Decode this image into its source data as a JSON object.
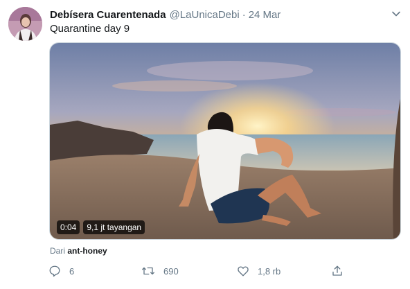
{
  "tweet": {
    "display_name": "Debísera Cuarentenada",
    "handle": "@LaUnicaDebi",
    "separator": "·",
    "date": "24 Mar",
    "text": "Quarantine day 9"
  },
  "video": {
    "duration": "0:04",
    "views": "9,1 jt tayangan"
  },
  "attribution": {
    "prefix": "Dari",
    "source": "ant-honey"
  },
  "actions": {
    "reply_count": "6",
    "retweet_count": "690",
    "like_count": "1,8 rb",
    "icons": [
      "reply-icon",
      "retweet-icon",
      "like-icon",
      "share-icon"
    ]
  },
  "colors": {
    "text": "#14171a",
    "secondary": "#657786",
    "border": "#ccd6dd"
  }
}
